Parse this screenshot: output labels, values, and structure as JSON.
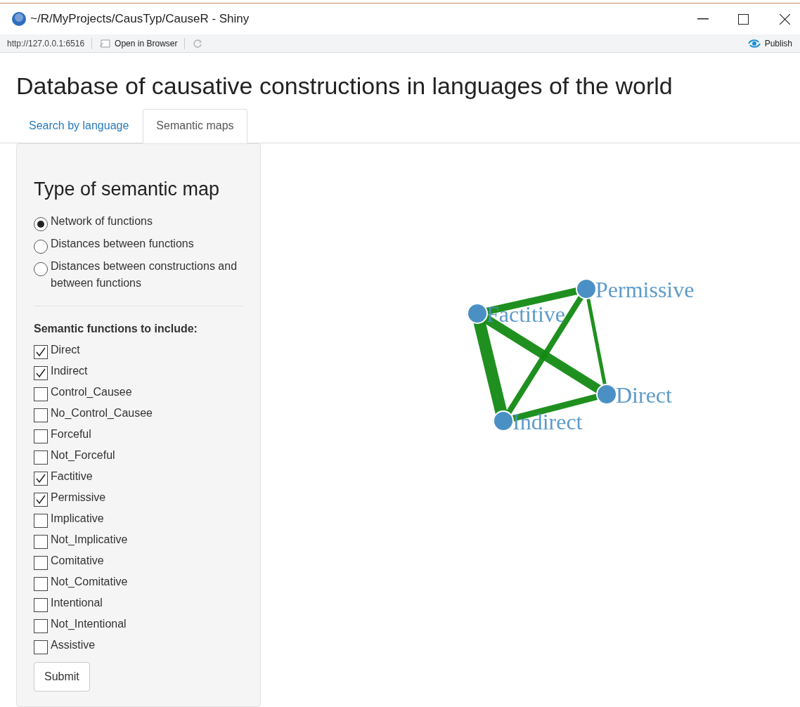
{
  "window": {
    "title": "~/R/MyProjects/CausTyp/CauseR - Shiny"
  },
  "toolbar": {
    "url": "http://127.0.0.1:6516",
    "open_in_browser": "Open in Browser",
    "publish": "Publish"
  },
  "page_title": "Database of causative constructions in languages of the world",
  "tabs": [
    {
      "label": "Search by language",
      "selected": false
    },
    {
      "label": "Semantic maps",
      "selected": true
    }
  ],
  "sidebar": {
    "heading": "Type of semantic map",
    "map_types": [
      {
        "label": "Network of functions",
        "selected": true
      },
      {
        "label": "Distances between functions",
        "selected": false
      },
      {
        "label": "Distances between constructions and between functions",
        "selected": false
      }
    ],
    "functions_label": "Semantic functions to include:",
    "functions": [
      {
        "label": "Direct",
        "checked": true
      },
      {
        "label": "Indirect",
        "checked": true
      },
      {
        "label": "Control_Causee",
        "checked": false
      },
      {
        "label": "No_Control_Causee",
        "checked": false
      },
      {
        "label": "Forceful",
        "checked": false
      },
      {
        "label": "Not_Forceful",
        "checked": false
      },
      {
        "label": "Factitive",
        "checked": true
      },
      {
        "label": "Permissive",
        "checked": true
      },
      {
        "label": "Implicative",
        "checked": false
      },
      {
        "label": "Not_Implicative",
        "checked": false
      },
      {
        "label": "Comitative",
        "checked": false
      },
      {
        "label": "Not_Comitative",
        "checked": false
      },
      {
        "label": "Intentional",
        "checked": false
      },
      {
        "label": "Not_Intentional",
        "checked": false
      },
      {
        "label": "Assistive",
        "checked": false
      }
    ],
    "submit": "Submit"
  },
  "network": {
    "nodes": [
      {
        "label": "Factitive"
      },
      {
        "label": "Permissive"
      },
      {
        "label": "Direct"
      },
      {
        "label": "Indirect"
      }
    ]
  }
}
